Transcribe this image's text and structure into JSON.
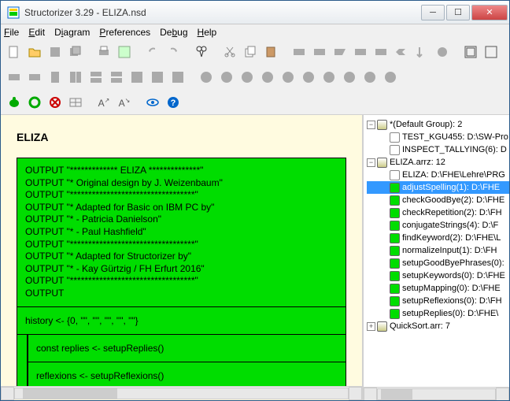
{
  "title": "Structorizer 3.29 - ELIZA.nsd",
  "menu": {
    "file": "File",
    "edit": "Edit",
    "diagram": "Diagram",
    "preferences": "Preferences",
    "debug": "Debug",
    "help": "Help"
  },
  "diagram": {
    "name": "ELIZA",
    "intro": [
      "OUTPUT \"************* ELIZA **************\"",
      "OUTPUT \"* Original design by J. Weizenbaum\"",
      "OUTPUT \"**********************************\"",
      "OUTPUT \"* Adapted for Basic on IBM PC by\"",
      "OUTPUT \"* - Patricia Danielson\"",
      "OUTPUT \"* - Paul Hashfield\"",
      "OUTPUT \"**********************************\"",
      "OUTPUT \"* Adapted for Structorizer by\"",
      "OUTPUT \"* - Kay Gürtzig / FH Erfurt 2016\"",
      "OUTPUT \"**********************************\"",
      "OUTPUT"
    ],
    "history": "history <- {0, \"\", \"\", \"\", \"\", \"\"}",
    "n1": "const replies <- setupReplies()",
    "n2": "reflexions <- setupReflexions()"
  },
  "tree": {
    "g1": "*(Default Group): 2",
    "g1a": "TEST_KGU455: D:\\SW-Pro",
    "g1b": "INSPECT_TALLYING(6): D",
    "g2": "ELIZA.arrz: 12",
    "items": [
      "ELIZA: D:\\FHE\\Lehre\\PRG",
      "adjustSpelling(1): D:\\FHE",
      "checkGoodBye(2): D:\\FHE",
      "checkRepetition(2): D:\\FH",
      "conjugateStrings(4): D:\\F",
      "findKeyword(2): D:\\FHE\\L",
      "normalizeInput(1): D:\\FH",
      "setupGoodByePhrases(0):",
      "setupKeywords(0): D:\\FHE",
      "setupMapping(0): D:\\FHE",
      "setupReflexions(0): D:\\FH",
      "setupReplies(0): D:\\FHE\\"
    ],
    "g3": "QuickSort.arr: 7"
  }
}
